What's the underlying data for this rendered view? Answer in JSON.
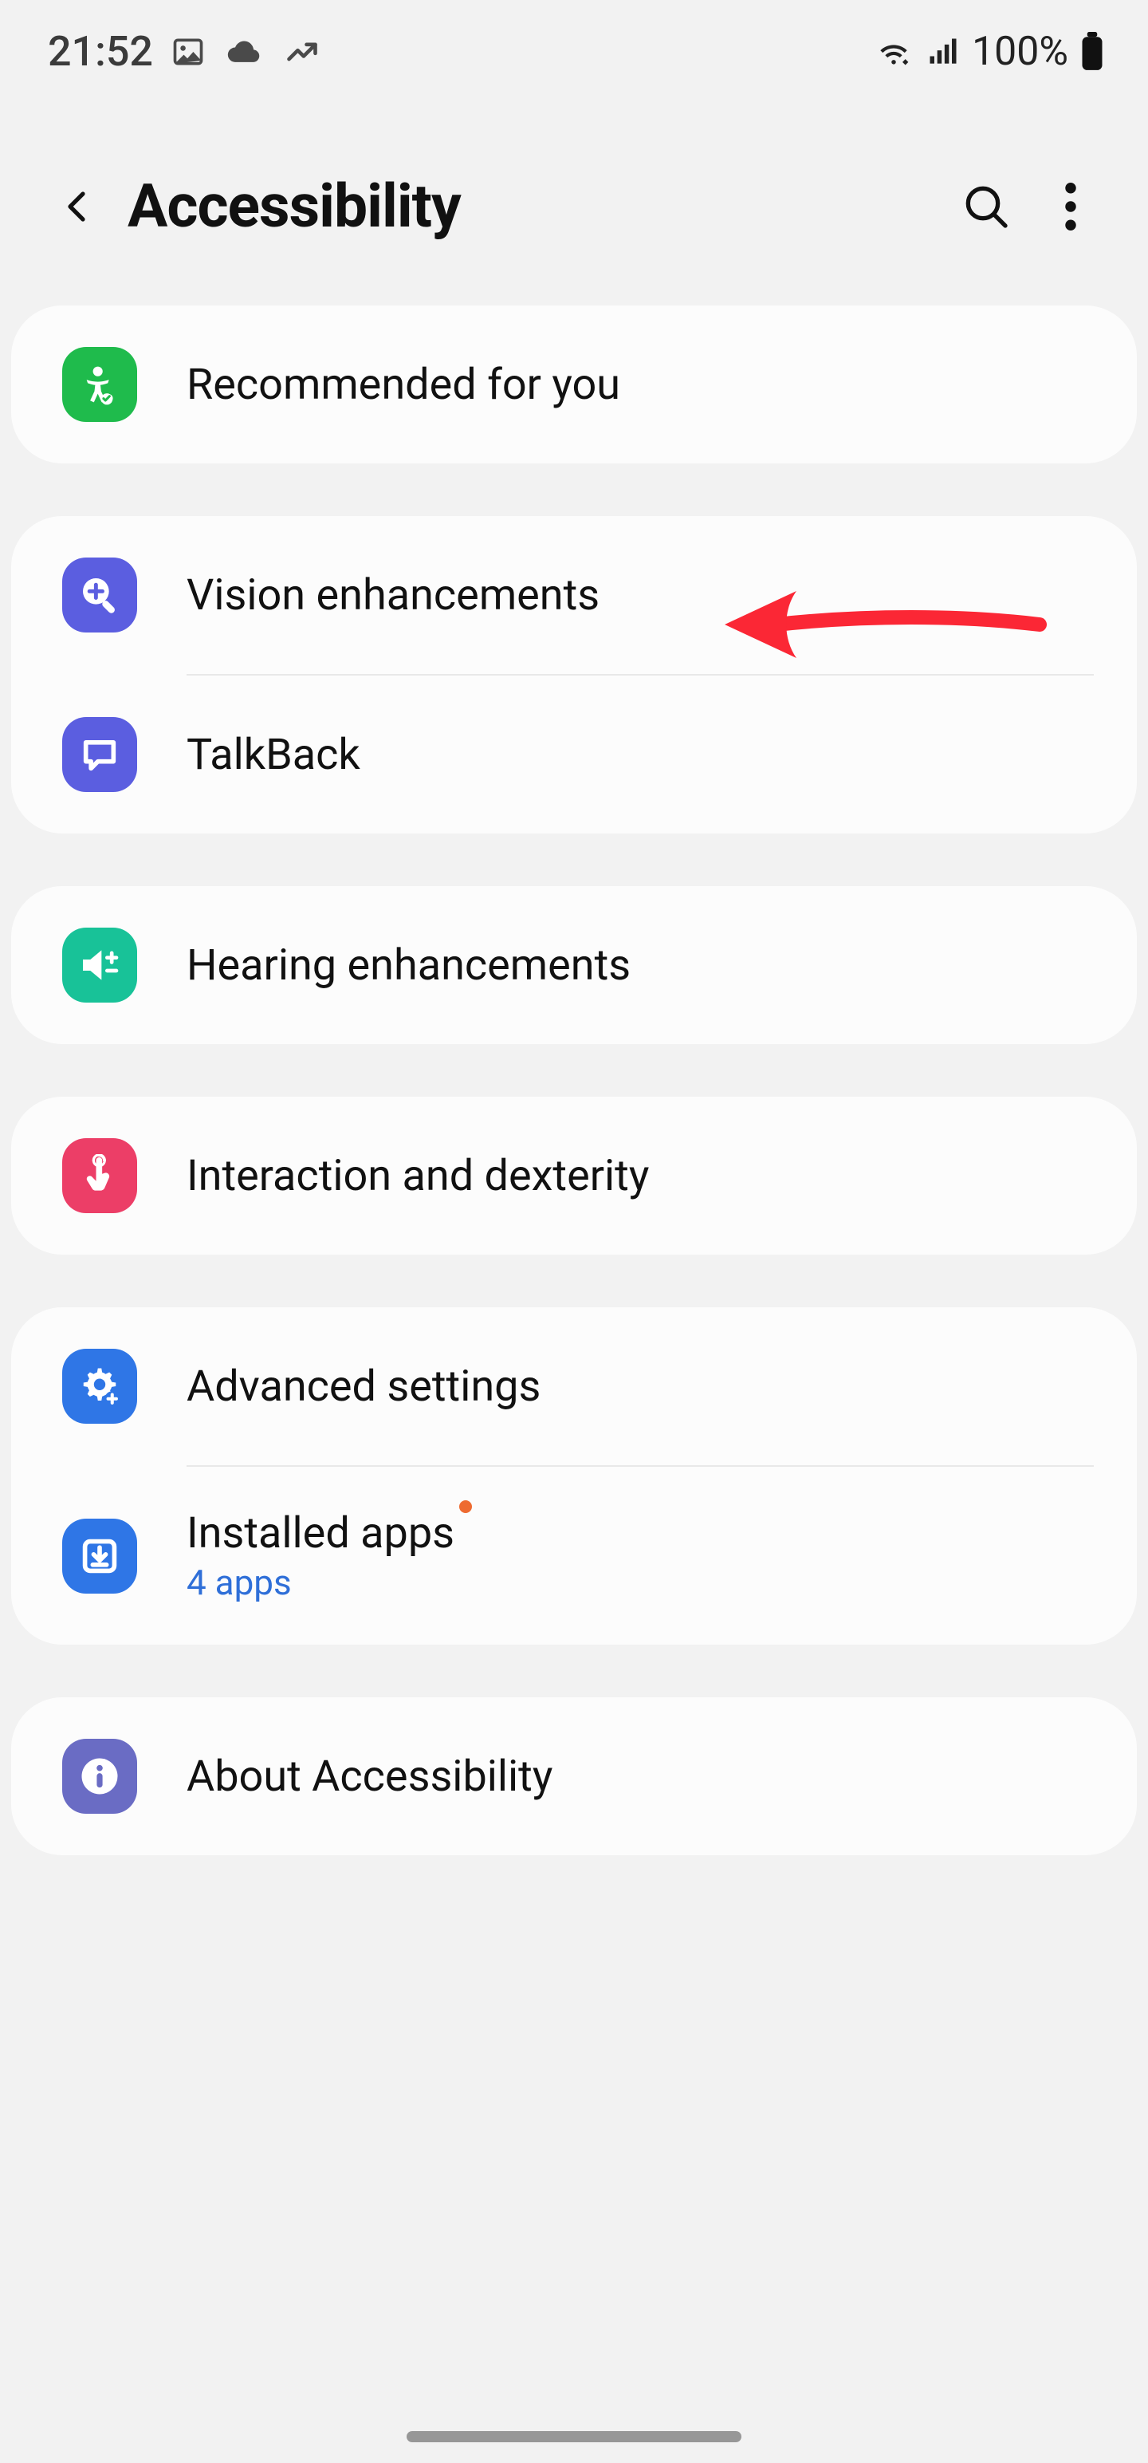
{
  "status": {
    "time": "21:52",
    "battery_text": "100%"
  },
  "header": {
    "title": "Accessibility"
  },
  "groups": [
    {
      "items": [
        {
          "label": "Recommended for you"
        }
      ]
    },
    {
      "items": [
        {
          "label": "Vision enhancements"
        },
        {
          "label": "TalkBack"
        }
      ]
    },
    {
      "items": [
        {
          "label": "Hearing enhancements"
        }
      ]
    },
    {
      "items": [
        {
          "label": "Interaction and dexterity"
        }
      ]
    },
    {
      "items": [
        {
          "label": "Advanced settings"
        },
        {
          "label": "Installed apps",
          "sub": "4 apps",
          "badge": true
        }
      ]
    },
    {
      "items": [
        {
          "label": "About Accessibility"
        }
      ]
    }
  ],
  "colors": {
    "recommended": "#1fbb4c",
    "vision": "#5b5ee0",
    "talkback": "#5b5ee0",
    "hearing": "#18c298",
    "interaction": "#ec3e67",
    "advanced": "#2f76e6",
    "installed": "#2f76e6",
    "about": "#6a6cc4"
  }
}
